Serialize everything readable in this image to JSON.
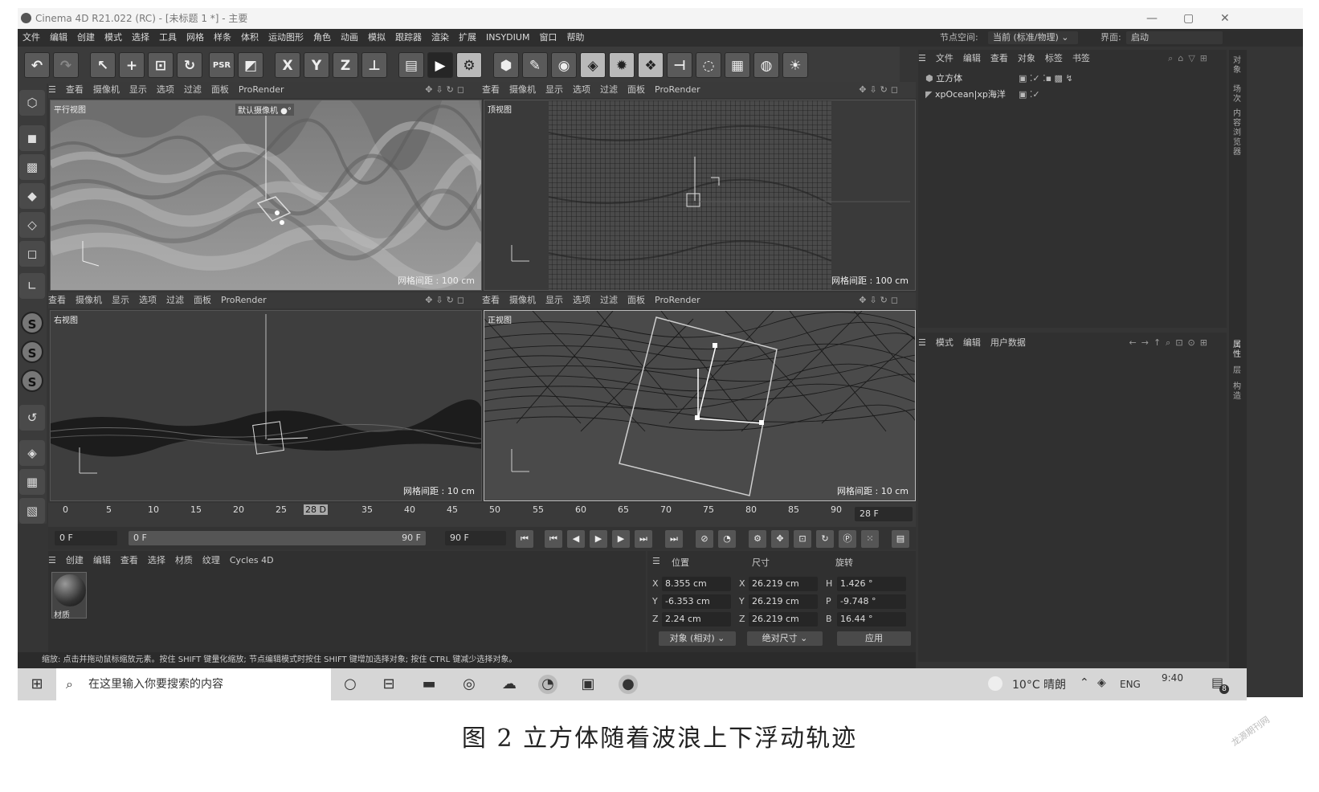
{
  "window": {
    "title": "Cinema 4D R21.022 (RC) - [未标题 1 *] - 主要",
    "min": "—",
    "max": "▢",
    "close": "✕"
  },
  "menu": {
    "items": [
      "文件",
      "编辑",
      "创建",
      "模式",
      "选择",
      "工具",
      "网格",
      "样条",
      "体积",
      "运动图形",
      "角色",
      "动画",
      "模拟",
      "跟踪器",
      "渲染",
      "扩展",
      "INSYDIUM",
      "窗口",
      "帮助"
    ],
    "node_space_label": "节点空间:",
    "node_space_value": "当前 (标准/物理)",
    "layout_label": "界面:",
    "layout_value": "启动"
  },
  "toolbar": {
    "undo": "↶",
    "redo": "↷",
    "select": "↖",
    "move": "+",
    "scale": "⊡",
    "rotate": "↻",
    "psr": "PSR",
    "x": "X",
    "y": "Y",
    "z": "Z",
    "world": "⊥",
    "render_region": "▤",
    "render_view": "▶",
    "render_settings": "⚙"
  },
  "viewport_menu": [
    "查看",
    "摄像机",
    "显示",
    "选项",
    "过滤",
    "面板",
    "ProRender"
  ],
  "viewports": {
    "perspective": {
      "label": "平行视图",
      "camera": "默认摄像机 ●°",
      "grid": "网格间距 : 100 cm"
    },
    "top": {
      "label": "顶视图",
      "grid": "网格间距 : 100 cm"
    },
    "right": {
      "label": "右视图",
      "grid": "网格间距 : 10 cm"
    },
    "front": {
      "label": "正视图",
      "grid": "网格间距 : 10 cm"
    }
  },
  "object_manager": {
    "menu": [
      "文件",
      "编辑",
      "查看",
      "对象",
      "标签",
      "书签"
    ],
    "objects": [
      "立方体",
      "xpOcean|xp海洋"
    ]
  },
  "attribute_manager": {
    "menu": [
      "模式",
      "编辑",
      "用户数据"
    ]
  },
  "side_tabs": [
    "对象",
    "场次",
    "内容浏览器",
    "属性",
    "层",
    "构造"
  ],
  "timeline": {
    "ticks": [
      "0",
      "5",
      "10",
      "15",
      "20",
      "25",
      "28 D",
      "35",
      "40",
      "45",
      "50",
      "55",
      "60",
      "65",
      "70",
      "75",
      "80",
      "85",
      "90"
    ],
    "current_frame": "28 F",
    "start": "0 F",
    "min": "0 F",
    "max_field": "90 F",
    "end": "90 F"
  },
  "material_manager": {
    "menu": [
      "创建",
      "编辑",
      "查看",
      "选择",
      "材质",
      "纹理",
      "Cycles 4D"
    ],
    "material_name": "材质"
  },
  "coordinates": {
    "headers": [
      "位置",
      "尺寸",
      "旋转"
    ],
    "rows": [
      {
        "axis": "X",
        "pos": "8.355 cm",
        "size_axis": "X",
        "size": "26.219 cm",
        "rot_axis": "H",
        "rot": "1.426 °"
      },
      {
        "axis": "Y",
        "pos": "-6.353 cm",
        "size_axis": "Y",
        "size": "26.219 cm",
        "rot_axis": "P",
        "rot": "-9.748 °"
      },
      {
        "axis": "Z",
        "pos": "2.24 cm",
        "size_axis": "Z",
        "size": "26.219 cm",
        "rot_axis": "B",
        "rot": "16.44 °"
      }
    ],
    "mode": "对象 (相对)",
    "size_mode": "绝对尺寸",
    "apply": "应用"
  },
  "status": "缩放: 点击并拖动鼠标缩放元素。按住 SHIFT 键量化缩放; 节点编辑模式时按住 SHIFT 键增加选择对象; 按住 CTRL 键减少选择对象。",
  "taskbar": {
    "search_placeholder": "在这里输入你要搜索的内容",
    "weather": "10°C 晴朗",
    "lang": "ENG",
    "time": "9:40",
    "notif": "8"
  },
  "caption": "图 2    立方体随着波浪上下浮动轨迹",
  "watermark": "龙源期刊网"
}
